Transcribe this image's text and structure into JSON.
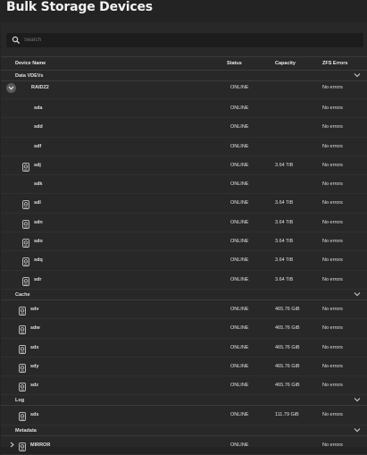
{
  "page": {
    "title": "Bulk Storage Devices"
  },
  "search": {
    "placeholder": "Search"
  },
  "table": {
    "headers": {
      "name": "Device Name",
      "status": "Status",
      "capacity": "Capacity",
      "errors": "ZFS Errors"
    },
    "groups": {
      "data": "Data VDEVs",
      "cache": "Cache",
      "log": "Log",
      "metadata": "Metadata"
    },
    "raidz2": {
      "name": "RAIDZ2",
      "status": "ONLINE",
      "capacity": "",
      "errors": "No errors"
    },
    "data_rows": [
      {
        "name": "sda",
        "status": "ONLINE",
        "capacity": "",
        "errors": "No errors",
        "icon": false
      },
      {
        "name": "sdd",
        "status": "ONLINE",
        "capacity": "",
        "errors": "No errors",
        "icon": false
      },
      {
        "name": "sdf",
        "status": "ONLINE",
        "capacity": "",
        "errors": "No errors",
        "icon": false
      },
      {
        "name": "sdj",
        "status": "ONLINE",
        "capacity": "3.64 TiB",
        "errors": "No errors",
        "icon": true
      },
      {
        "name": "sdk",
        "status": "ONLINE",
        "capacity": "",
        "errors": "No errors",
        "icon": false
      },
      {
        "name": "sdl",
        "status": "ONLINE",
        "capacity": "3.64 TiB",
        "errors": "No errors",
        "icon": true
      },
      {
        "name": "sdn",
        "status": "ONLINE",
        "capacity": "3.64 TiB",
        "errors": "No errors",
        "icon": true
      },
      {
        "name": "sdo",
        "status": "ONLINE",
        "capacity": "3.64 TiB",
        "errors": "No errors",
        "icon": true
      },
      {
        "name": "sdq",
        "status": "ONLINE",
        "capacity": "3.64 TiB",
        "errors": "No errors",
        "icon": true
      },
      {
        "name": "sdr",
        "status": "ONLINE",
        "capacity": "3.64 TiB",
        "errors": "No errors",
        "icon": true
      }
    ],
    "cache_rows": [
      {
        "name": "sdv",
        "status": "ONLINE",
        "capacity": "465.76 GiB",
        "errors": "No errors"
      },
      {
        "name": "sdw",
        "status": "ONLINE",
        "capacity": "465.76 GiB",
        "errors": "No errors"
      },
      {
        "name": "sdx",
        "status": "ONLINE",
        "capacity": "465.76 GiB",
        "errors": "No errors"
      },
      {
        "name": "sdy",
        "status": "ONLINE",
        "capacity": "465.76 GiB",
        "errors": "No errors"
      },
      {
        "name": "sdz",
        "status": "ONLINE",
        "capacity": "465.76 GiB",
        "errors": "No errors"
      }
    ],
    "log_rows": [
      {
        "name": "sds",
        "status": "ONLINE",
        "capacity": "111.79 GiB",
        "errors": "No errors"
      }
    ],
    "metadata_rows": [
      {
        "name": "MIRROR",
        "status": "ONLINE",
        "capacity": "",
        "errors": "No errors"
      }
    ]
  }
}
